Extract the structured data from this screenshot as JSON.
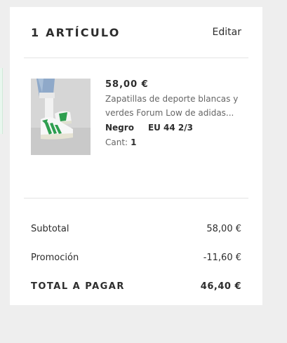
{
  "bag": {
    "title": "1 ARTÍCULO",
    "edit_label": "Editar"
  },
  "item": {
    "price": "58,00 €",
    "description": "Zapatillas de deporte blancas y verdes Forum Low de adidas...",
    "color": "Negro",
    "size": "EU 44 2/3",
    "qty_label": "Cant:",
    "qty_value": "1",
    "image_icon": "sneaker-photo"
  },
  "totals": {
    "subtotal_label": "Subtotal",
    "subtotal_value": "58,00 €",
    "promo_label": "Promoción",
    "promo_value": "-11,60 €",
    "total_label": "TOTAL A PAGAR",
    "total_value": "46,40 €"
  },
  "colors": {
    "panel_bg": "#ffffff",
    "page_bg": "#eeeeee",
    "text": "#2d2d2d",
    "muted": "#666666",
    "shoe_green": "#2e9e4f"
  }
}
